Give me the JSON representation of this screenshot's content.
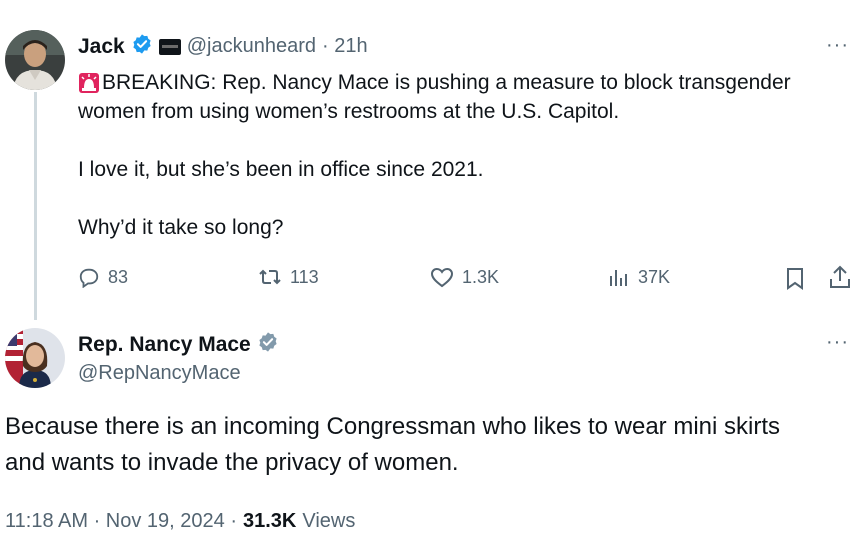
{
  "colors": {
    "verified_blue": "#1d9bf0",
    "gov_gray": "#829aab",
    "text_secondary": "#536471",
    "thread_line": "#cfd9de",
    "alert_red": "#e0245e"
  },
  "tweet": {
    "author_name": "Jack",
    "handle": "@jackunheard",
    "time": "· 21h",
    "more": "···",
    "affiliate_badge_text": "BREAKING",
    "alert_icon": "rotating-light-icon",
    "line1": "BREAKING: Rep. Nancy Mace is pushing a measure to block transgender",
    "line2": "women from using women’s restrooms at the U.S. Capitol.",
    "line3": "I love it, but she’s been in office since 2021.",
    "line4": "Why’d it take so long?",
    "actions": {
      "replies": "83",
      "reposts": "113",
      "likes": "1.3K",
      "views": "37K"
    }
  },
  "reply": {
    "author_name": "Rep. Nancy Mace",
    "handle": "@RepNancyMace",
    "more": "···",
    "line1": "Because there is an incoming Congressman who likes to wear mini skirts",
    "line2": "and wants to invade the privacy of women.",
    "time": "11:18 AM · Nov 19, 2024 ·",
    "views_count": "31.3K",
    "views_label": "Views"
  }
}
